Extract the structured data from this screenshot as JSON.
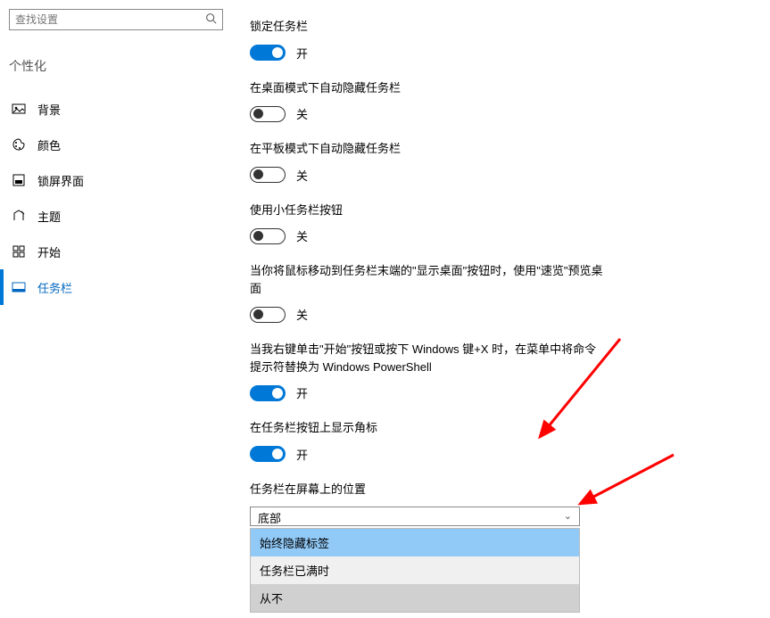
{
  "search": {
    "placeholder": "查找设置"
  },
  "sidebar": {
    "section": "个性化",
    "items": [
      {
        "label": "背景"
      },
      {
        "label": "颜色"
      },
      {
        "label": "锁屏界面"
      },
      {
        "label": "主题"
      },
      {
        "label": "开始"
      },
      {
        "label": "任务栏"
      }
    ]
  },
  "settings": {
    "lock_taskbar": {
      "label": "锁定任务栏",
      "state": "开"
    },
    "autohide_desktop": {
      "label": "在桌面模式下自动隐藏任务栏",
      "state": "关"
    },
    "autohide_tablet": {
      "label": "在平板模式下自动隐藏任务栏",
      "state": "关"
    },
    "small_buttons": {
      "label": "使用小任务栏按钮",
      "state": "关"
    },
    "peek": {
      "label": "当你将鼠标移动到任务栏末端的\"显示桌面\"按钮时，使用\"速览\"预览桌面",
      "state": "关"
    },
    "powershell": {
      "label": "当我右键单击\"开始\"按钮或按下 Windows 键+X 时，在菜单中将命令提示符替换为 Windows PowerShell",
      "state": "开"
    },
    "badges": {
      "label": "在任务栏按钮上显示角标",
      "state": "开"
    },
    "position": {
      "label": "任务栏在屏幕上的位置",
      "value": "底部"
    },
    "combine_options": {
      "items": [
        {
          "label": "始终隐藏标签"
        },
        {
          "label": "任务栏已满时"
        },
        {
          "label": "从不"
        }
      ]
    }
  }
}
